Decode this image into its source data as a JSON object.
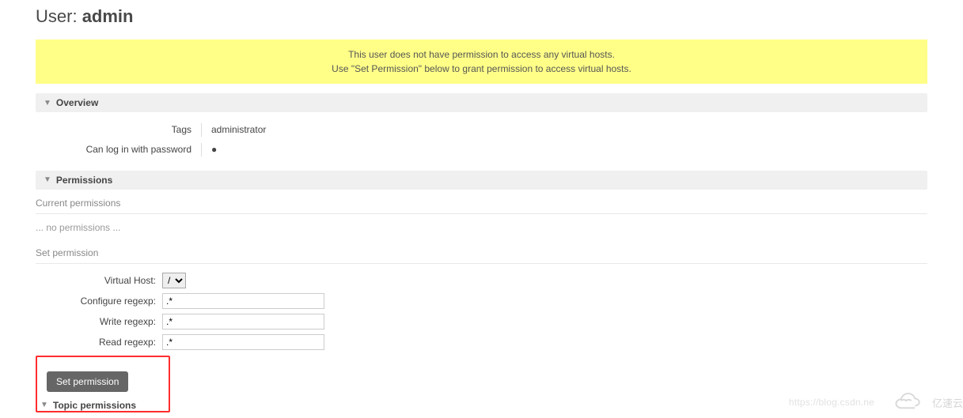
{
  "page_title_prefix": "User: ",
  "page_title_user": "admin",
  "banner": {
    "line1": "This user does not have permission to access any virtual hosts.",
    "line2": "Use \"Set Permission\" below to grant permission to access virtual hosts."
  },
  "overview": {
    "header": "Overview",
    "rows": {
      "tags_label": "Tags",
      "tags_value": "administrator",
      "login_label": "Can log in with password",
      "login_value": "●"
    }
  },
  "permissions": {
    "header": "Permissions",
    "current_head": "Current permissions",
    "none_text": "... no permissions ...",
    "set_head": "Set permission",
    "form": {
      "vhost_label": "Virtual Host:",
      "vhost_value": "/",
      "configure_label": "Configure regexp:",
      "configure_value": ".*",
      "write_label": "Write regexp:",
      "write_value": ".*",
      "read_label": "Read regexp:",
      "read_value": ".*",
      "button": "Set permission"
    }
  },
  "topic": {
    "header": "Topic permissions"
  },
  "watermark": {
    "url": "https://blog.csdn.ne",
    "brand": "亿速云"
  }
}
